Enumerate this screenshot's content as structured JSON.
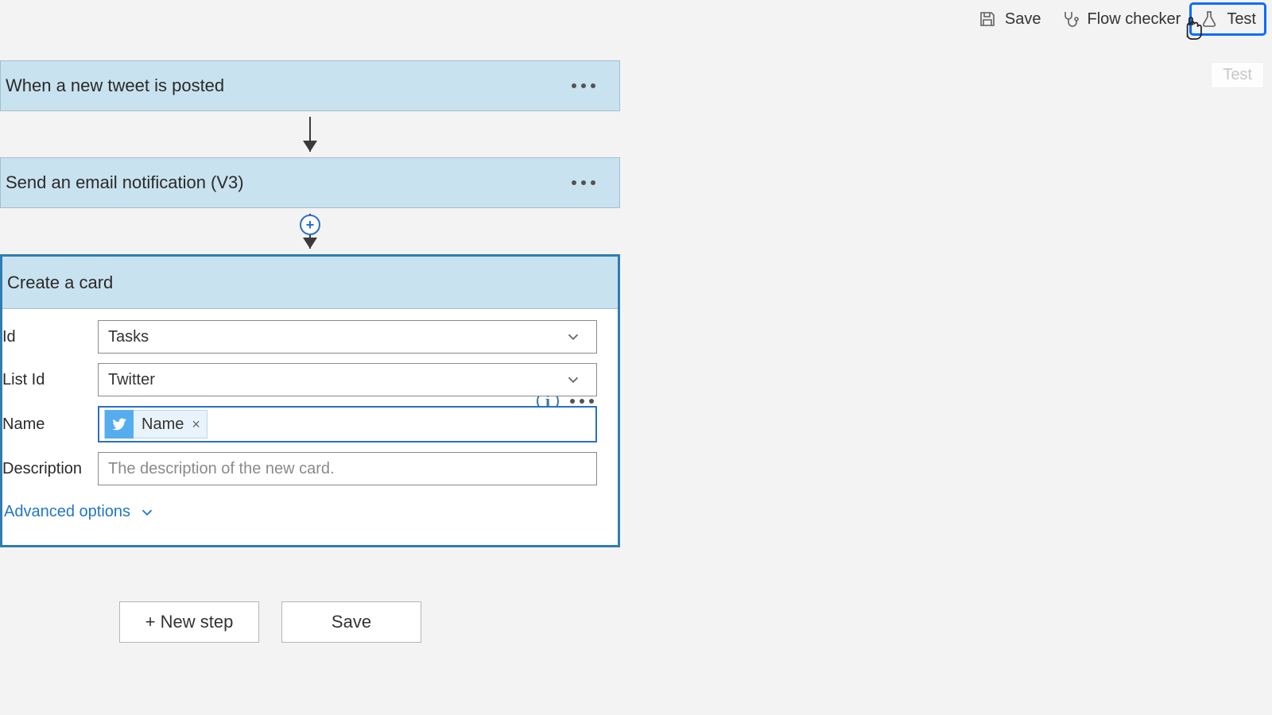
{
  "toolbar": {
    "save": "Save",
    "flow_checker": "Flow checker",
    "test": "Test"
  },
  "tooltip": "Test",
  "steps": {
    "trigger": {
      "title": "When a new tweet is posted"
    },
    "email": {
      "title": "Send an email notification (V3)"
    }
  },
  "card": {
    "title": "Create a card",
    "fields": {
      "board": {
        "label": "Id",
        "value": "Tasks"
      },
      "list": {
        "label": "List Id",
        "value": "Twitter"
      },
      "name": {
        "label": "Name",
        "token": "Name"
      },
      "desc": {
        "label": "Description",
        "placeholder": "The description of the new card."
      }
    },
    "advanced": "Advanced options"
  },
  "bottom": {
    "new_step": "+ New step",
    "save": "Save"
  }
}
